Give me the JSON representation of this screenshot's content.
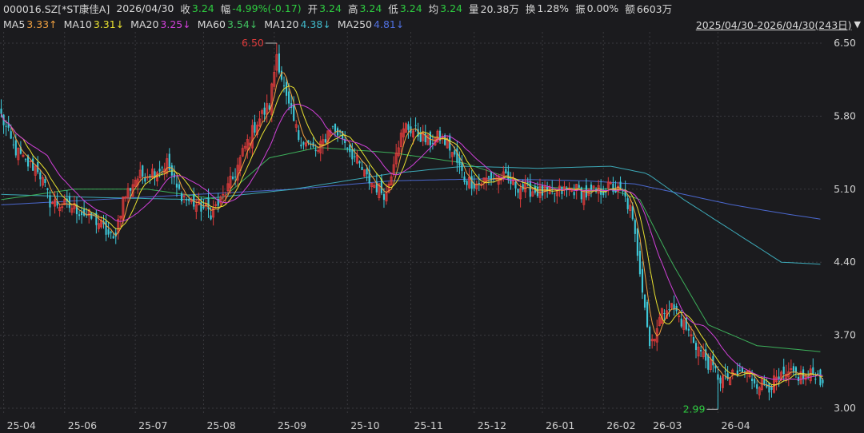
{
  "header": {
    "symbol": "000016.SZ[*ST康佳A]",
    "date": "2026/04/30",
    "close_label": "收",
    "close": "3.24",
    "change_label": "幅",
    "change": "-4.99%(-0.17)",
    "open_label": "开",
    "open": "3.24",
    "high_label": "高",
    "high": "3.24",
    "low_label": "低",
    "low": "3.24",
    "avg_label": "均",
    "avg": "3.24",
    "volume_label": "量",
    "volume": "20.38万",
    "turnover_label": "换",
    "turnover": "1.28%",
    "amplitude_label": "振",
    "amplitude": "0.00%",
    "amount_label": "额",
    "amount": "6603万"
  },
  "ma_bar": {
    "items": [
      {
        "name": "MA5",
        "value": "3.33↑",
        "color": "#f0a040"
      },
      {
        "name": "MA10",
        "value": "3.31↓",
        "color": "#e8e030"
      },
      {
        "name": "MA20",
        "value": "3.25↓",
        "color": "#d040d8"
      },
      {
        "name": "MA60",
        "value": "3.54↓",
        "color": "#40c060"
      },
      {
        "name": "MA120",
        "value": "4.38↓",
        "color": "#40b8c8"
      },
      {
        "name": "MA250",
        "value": "4.81↓",
        "color": "#5070e0"
      }
    ],
    "range": "2025/04/30-2026/04/30(243日)",
    "range_icon": "caret-down-icon"
  },
  "colors": {
    "up": "#e03c3c",
    "down": "#3ec8d8",
    "flat_green": "#2ecc40",
    "green_text": "#2ecc40"
  },
  "chart_data": {
    "type": "candlestick",
    "y_ticks": [
      "6.50",
      "5.80",
      "5.10",
      "4.40",
      "3.70",
      "3.00"
    ],
    "ylim": [
      3.0,
      6.5
    ],
    "x_ticks": [
      "25-04",
      "25-06",
      "25-07",
      "25-08",
      "25-09",
      "25-10",
      "25-11",
      "25-12",
      "26-01",
      "26-02",
      "26-03",
      "26-04"
    ],
    "x_tick_bar_index": [
      1,
      26,
      55,
      83,
      112,
      142,
      168,
      194,
      222,
      247,
      266,
      294
    ],
    "annotations": [
      {
        "text": "6.50",
        "bar_index": 113,
        "value": 6.5,
        "color": "#e03c3c"
      },
      {
        "text": "2.99",
        "bar_index": 294,
        "value": 2.99,
        "color": "#2ecc40"
      }
    ],
    "anchors": [
      [
        0,
        5.8
      ],
      [
        5,
        5.5
      ],
      [
        10,
        5.35
      ],
      [
        15,
        5.3
      ],
      [
        20,
        4.98
      ],
      [
        25,
        4.95
      ],
      [
        30,
        4.92
      ],
      [
        35,
        4.85
      ],
      [
        40,
        4.78
      ],
      [
        46,
        4.6
      ],
      [
        50,
        5.0
      ],
      [
        55,
        5.2
      ],
      [
        60,
        5.25
      ],
      [
        65,
        5.3
      ],
      [
        68,
        5.35
      ],
      [
        72,
        5.1
      ],
      [
        76,
        5.0
      ],
      [
        80,
        4.95
      ],
      [
        86,
        4.88
      ],
      [
        90,
        4.98
      ],
      [
        95,
        5.2
      ],
      [
        100,
        5.5
      ],
      [
        105,
        5.75
      ],
      [
        110,
        5.9
      ],
      [
        113,
        6.4
      ],
      [
        117,
        5.95
      ],
      [
        122,
        5.6
      ],
      [
        127,
        5.5
      ],
      [
        130,
        5.45
      ],
      [
        135,
        5.7
      ],
      [
        140,
        5.6
      ],
      [
        145,
        5.4
      ],
      [
        150,
        5.2
      ],
      [
        155,
        5.1
      ],
      [
        158,
        5.05
      ],
      [
        162,
        5.5
      ],
      [
        166,
        5.7
      ],
      [
        170,
        5.65
      ],
      [
        175,
        5.55
      ],
      [
        180,
        5.6
      ],
      [
        184,
        5.5
      ],
      [
        187,
        5.35
      ],
      [
        190,
        5.2
      ],
      [
        195,
        5.15
      ],
      [
        200,
        5.2
      ],
      [
        205,
        5.22
      ],
      [
        210,
        5.15
      ],
      [
        215,
        5.1
      ],
      [
        220,
        5.08
      ],
      [
        225,
        5.05
      ],
      [
        230,
        5.08
      ],
      [
        235,
        5.1
      ],
      [
        240,
        5.05
      ],
      [
        245,
        5.08
      ],
      [
        250,
        5.12
      ],
      [
        255,
        5.05
      ],
      [
        258,
        4.9
      ],
      [
        261,
        4.5
      ],
      [
        264,
        4.0
      ],
      [
        266,
        3.6
      ],
      [
        270,
        3.85
      ],
      [
        273,
        4.0
      ],
      [
        276,
        3.95
      ],
      [
        280,
        3.8
      ],
      [
        284,
        3.65
      ],
      [
        288,
        3.5
      ],
      [
        291,
        3.4
      ],
      [
        295,
        3.28
      ],
      [
        300,
        3.3
      ],
      [
        305,
        3.35
      ],
      [
        310,
        3.25
      ],
      [
        315,
        3.22
      ],
      [
        320,
        3.28
      ],
      [
        325,
        3.32
      ],
      [
        330,
        3.3
      ],
      [
        334,
        3.34
      ],
      [
        337,
        3.24
      ]
    ],
    "ma_series": [
      {
        "name": "MA250",
        "values": [
          [
            0,
            4.95
          ],
          [
            40,
            5.0
          ],
          [
            80,
            5.05
          ],
          [
            120,
            5.1
          ],
          [
            160,
            5.18
          ],
          [
            200,
            5.2
          ],
          [
            240,
            5.18
          ],
          [
            260,
            5.15
          ],
          [
            280,
            5.05
          ],
          [
            300,
            4.95
          ],
          [
            320,
            4.87
          ],
          [
            337,
            4.81
          ]
        ]
      },
      {
        "name": "MA120",
        "values": [
          [
            0,
            5.05
          ],
          [
            40,
            5.02
          ],
          [
            80,
            5.0
          ],
          [
            120,
            5.1
          ],
          [
            160,
            5.25
          ],
          [
            190,
            5.32
          ],
          [
            220,
            5.3
          ],
          [
            250,
            5.32
          ],
          [
            265,
            5.25
          ],
          [
            280,
            5.0
          ],
          [
            300,
            4.7
          ],
          [
            320,
            4.4
          ],
          [
            337,
            4.38
          ]
        ]
      },
      {
        "name": "MA60",
        "values": [
          [
            0,
            5.0
          ],
          [
            30,
            5.1
          ],
          [
            60,
            5.1
          ],
          [
            90,
            5.0
          ],
          [
            110,
            5.4
          ],
          [
            130,
            5.5
          ],
          [
            160,
            5.45
          ],
          [
            190,
            5.35
          ],
          [
            220,
            5.12
          ],
          [
            250,
            5.1
          ],
          [
            262,
            5.0
          ],
          [
            275,
            4.4
          ],
          [
            290,
            3.8
          ],
          [
            310,
            3.6
          ],
          [
            337,
            3.54
          ]
        ]
      }
    ],
    "short_mas": [
      {
        "name": "MA5",
        "window": 5
      },
      {
        "name": "MA10",
        "window": 10
      },
      {
        "name": "MA20",
        "window": 20
      }
    ]
  }
}
